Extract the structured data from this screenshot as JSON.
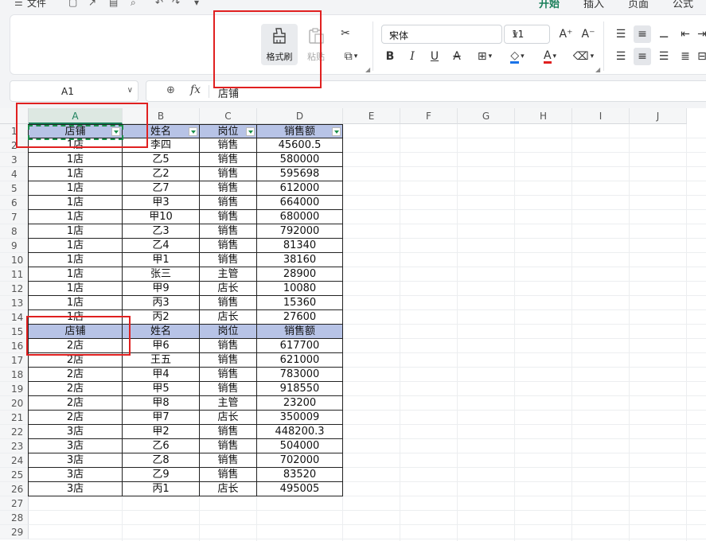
{
  "menu": {
    "file_label": "文件",
    "tabs": [
      {
        "label": "开始",
        "active": true
      },
      {
        "label": "插入",
        "active": false
      },
      {
        "label": "页面",
        "active": false
      },
      {
        "label": "公式",
        "active": false
      }
    ]
  },
  "ribbon": {
    "format_painter_label": "格式刷",
    "paste_label": "粘贴",
    "font_name": "宋体",
    "font_size": "11",
    "buttons": {
      "increase_font": "A⁺",
      "decrease_font": "A⁻",
      "bold": "B",
      "italic": "I",
      "underline": "U",
      "strikethrough": "A",
      "font_color": "A"
    },
    "font_color_hex": "#e02020",
    "fill_color_hex": "#1a73e8"
  },
  "formula_bar": {
    "name_box": "A1",
    "fx": "fx",
    "value": "店铺"
  },
  "columns": [
    "A",
    "B",
    "C",
    "D",
    "E",
    "F",
    "G",
    "H",
    "I",
    "J"
  ],
  "row_numbers": [
    "1",
    "2",
    "3",
    "4",
    "5",
    "6",
    "7",
    "8",
    "9",
    "10",
    "11",
    "12",
    "13",
    "14",
    "15",
    "16",
    "17",
    "18",
    "19",
    "20",
    "21",
    "22",
    "23",
    "24",
    "25",
    "26",
    "27",
    "28",
    "29"
  ],
  "table": {
    "rows": [
      [
        "店铺",
        "姓名",
        "岗位",
        "销售额"
      ],
      [
        "1店",
        "李四",
        "销售",
        "45600.5"
      ],
      [
        "1店",
        "乙5",
        "销售",
        "580000"
      ],
      [
        "1店",
        "乙2",
        "销售",
        "595698"
      ],
      [
        "1店",
        "乙7",
        "销售",
        "612000"
      ],
      [
        "1店",
        "甲3",
        "销售",
        "664000"
      ],
      [
        "1店",
        "甲10",
        "销售",
        "680000"
      ],
      [
        "1店",
        "乙3",
        "销售",
        "792000"
      ],
      [
        "1店",
        "乙4",
        "销售",
        "81340"
      ],
      [
        "1店",
        "甲1",
        "销售",
        "38160"
      ],
      [
        "1店",
        "张三",
        "主管",
        "28900"
      ],
      [
        "1店",
        "甲9",
        "店长",
        "10080"
      ],
      [
        "1店",
        "丙3",
        "销售",
        "15360"
      ],
      [
        "1店",
        "丙2",
        "店长",
        "27600"
      ],
      [
        "店铺",
        "姓名",
        "岗位",
        "销售额"
      ],
      [
        "2店",
        "甲6",
        "销售",
        "617700"
      ],
      [
        "2店",
        "王五",
        "销售",
        "621000"
      ],
      [
        "2店",
        "甲4",
        "销售",
        "783000"
      ],
      [
        "2店",
        "甲5",
        "销售",
        "918550"
      ],
      [
        "2店",
        "甲8",
        "主管",
        "23200"
      ],
      [
        "2店",
        "甲7",
        "店长",
        "350009"
      ],
      [
        "3店",
        "甲2",
        "销售",
        "448200.3"
      ],
      [
        "3店",
        "乙6",
        "销售",
        "504000"
      ],
      [
        "3店",
        "乙8",
        "销售",
        "702000"
      ],
      [
        "3店",
        "乙9",
        "销售",
        "83520"
      ],
      [
        "3店",
        "丙1",
        "店长",
        "495005"
      ]
    ],
    "header_fill": "#b7c3e6"
  },
  "annotation_color": "#e02020"
}
